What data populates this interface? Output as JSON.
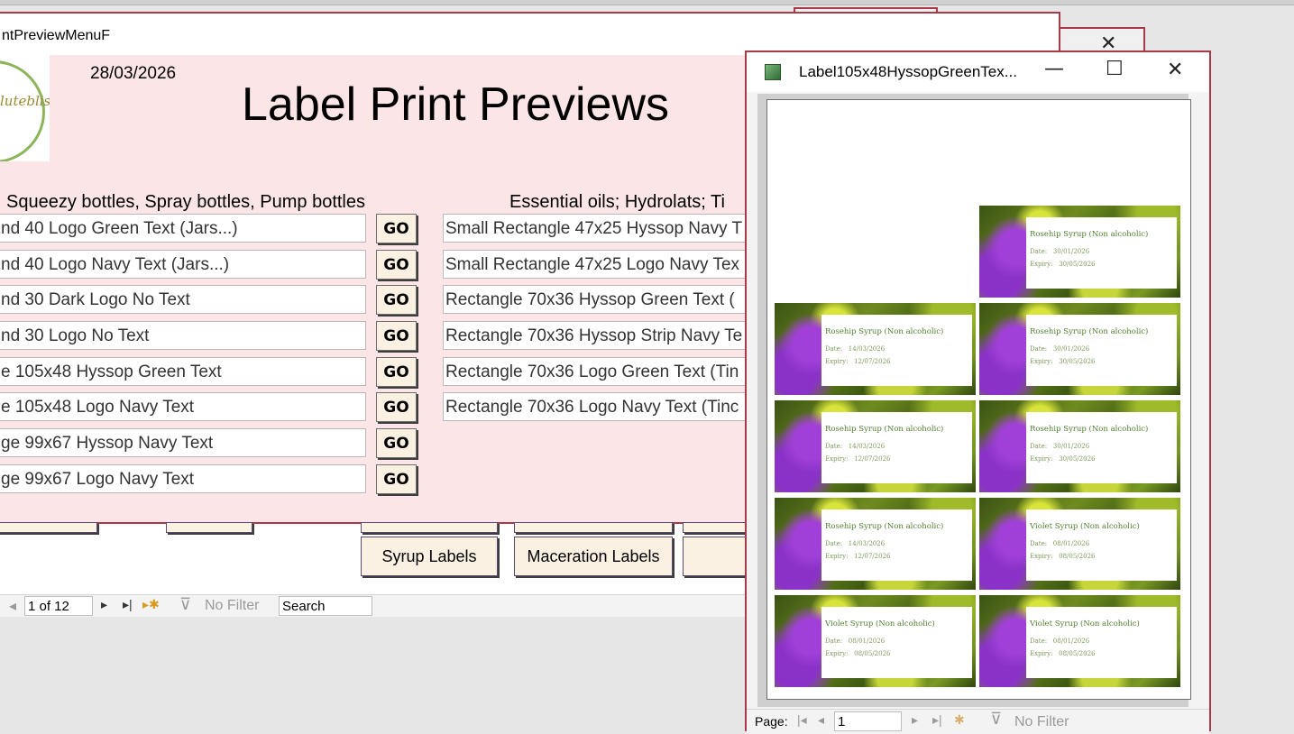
{
  "form": {
    "title": "ntPreviewMenuF",
    "date": "28/03/2026",
    "logo_text": "lutebliss",
    "heading": "Label Print Previews",
    "left_header": "Squeezy bottles, Spray bottles, Pump bottles",
    "right_header": "Essential oils; Hydrolats; Ti",
    "go_label": "GO",
    "left_items": [
      "nd 40 Logo Green Text (Jars...)",
      "nd 40 Logo Navy Text (Jars...)",
      "nd 30 Dark Logo No Text",
      "nd 30 Logo No Text",
      "e 105x48 Hyssop Green Text",
      "e 105x48 Logo Navy Text",
      "ge 99x67  Hyssop Navy Text",
      "ge 99x67 Logo Navy Text"
    ],
    "right_items": [
      "Small Rectangle 47x25 Hyssop Navy T",
      "Small Rectangle 47x25 Logo Navy Tex",
      "Rectangle 70x36 Hyssop Green Text (",
      "Rectangle 70x36 Hyssop Strip Navy Te",
      "Rectangle 70x36 Logo Green Text (Tin",
      "Rectangle 70x36 Logo Navy Text (Tinc"
    ],
    "bottom_buttons": [
      "Syrup Labels",
      "Maceration Labels",
      ""
    ],
    "nav": {
      "record": "1 of 12",
      "filter": "No Filter",
      "search": "Search"
    }
  },
  "preview": {
    "title": "Label105x48HyssopGreenTex...",
    "date_label": "Date:",
    "expiry_label": "Expiry:",
    "labels": [
      {
        "name": "Rosehip Syrup (Non alcoholic)",
        "date": "30/01/2026",
        "expiry": "30/05/2026"
      },
      {
        "name": "Rosehip Syrup (Non alcoholic)",
        "date": "14/03/2026",
        "expiry": "12/07/2026"
      },
      {
        "name": "Rosehip Syrup (Non alcoholic)",
        "date": "30/01/2026",
        "expiry": "30/05/2026"
      },
      {
        "name": "Rosehip Syrup (Non alcoholic)",
        "date": "14/03/2026",
        "expiry": "12/07/2026"
      },
      {
        "name": "Rosehip Syrup (Non alcoholic)",
        "date": "30/01/2026",
        "expiry": "30/05/2026"
      },
      {
        "name": "Rosehip Syrup (Non alcoholic)",
        "date": "14/03/2026",
        "expiry": "12/07/2026"
      },
      {
        "name": "Violet Syrup (Non alcoholic)",
        "date": "08/01/2026",
        "expiry": "08/05/2026"
      },
      {
        "name": "Violet Syrup (Non alcoholic)",
        "date": "08/01/2026",
        "expiry": "08/05/2026"
      },
      {
        "name": "Violet Syrup (Non alcoholic)",
        "date": "08/01/2026",
        "expiry": "08/05/2026"
      }
    ],
    "nav": {
      "page_label": "Page:",
      "page": "1",
      "filter": "No Filter"
    }
  },
  "colors": {
    "accent_border": "#a83a48",
    "form_bg": "#fbe5e6",
    "button_bg": "#fbf1e2"
  }
}
